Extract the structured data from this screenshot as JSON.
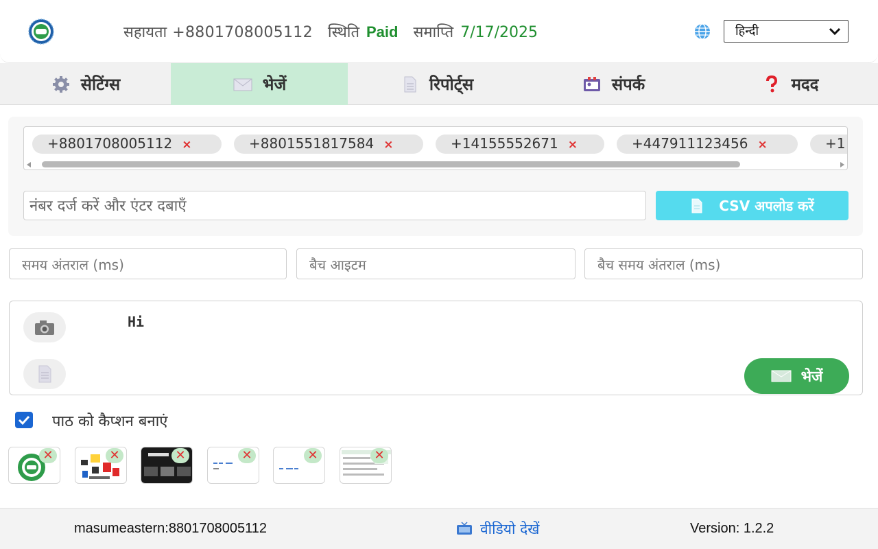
{
  "header": {
    "support_label": "सहायता",
    "support_phone": "+8801708005112",
    "status_label": "स्थिति",
    "status_value": "Paid",
    "expiry_label": "समाप्ति",
    "expiry_date": "7/17/2025",
    "language": "हिन्दी",
    "logo_icon": "logo-emblem-icon",
    "globe_icon": "globe-icon"
  },
  "tabs": [
    {
      "label": "सेटिंग्स",
      "icon": "gear-icon",
      "active": false
    },
    {
      "label": "भेजें",
      "icon": "envelope-icon",
      "active": true
    },
    {
      "label": "रिपोर्ट्स",
      "icon": "document-icon",
      "active": false
    },
    {
      "label": "संपर्क",
      "icon": "contact-card-icon",
      "active": false
    },
    {
      "label": "मदद",
      "icon": "question-icon",
      "active": false
    }
  ],
  "numbers": {
    "chips": [
      "+8801708005112",
      "+8801551817584",
      "+14155552671",
      "+447911123456",
      "+1"
    ],
    "remove_glyph": "×",
    "input_placeholder": "नंबर दर्ज करें और एंटर दबाएँ",
    "csv_button": "CSV अपलोड करें"
  },
  "intervals": {
    "time_interval_placeholder": "समय अंतराल (ms)",
    "batch_items_placeholder": "बैच आइटम",
    "batch_interval_placeholder": "बैच समय अंतराल (ms)"
  },
  "message": {
    "text": "Hi",
    "send_button": "भेजें"
  },
  "caption": {
    "label": "पाठ को कैप्शन बनाएं",
    "checked": true
  },
  "attachments": {
    "remove_glyph": "✕"
  },
  "footer": {
    "user": "masumeastern:8801708005112",
    "video_link": "वीडियो देखें",
    "version": "Version: 1.2.2"
  },
  "colors": {
    "accent_green": "#3dab57",
    "paid_green": "#1f8f2f",
    "csv_cyan": "#55dbee",
    "link_blue": "#1a66d2",
    "active_tab": "#c9ecd6"
  }
}
